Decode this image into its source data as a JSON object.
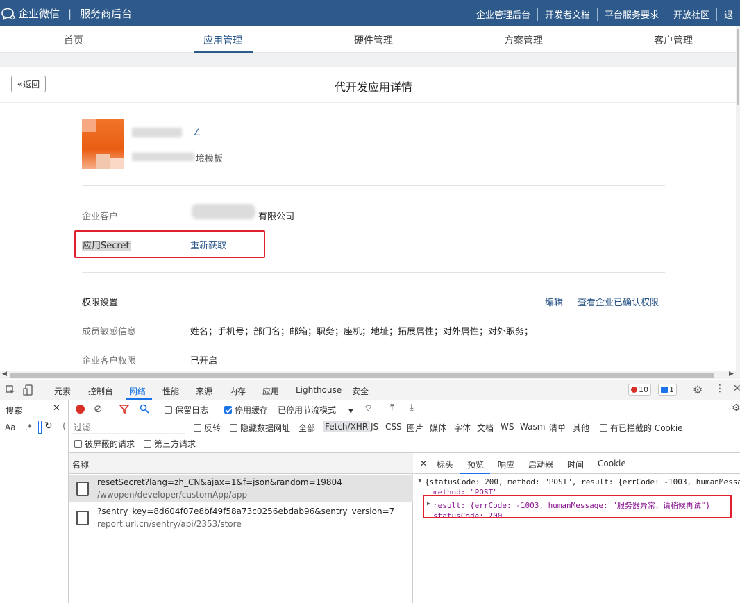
{
  "topbar": {
    "brand": "企业微信",
    "section": "服务商后台",
    "links": [
      "企业管理后台",
      "开发者文档",
      "平台服务要求",
      "开放社区",
      "退"
    ]
  },
  "subnav": {
    "tabs": [
      "首页",
      "应用管理",
      "硬件管理",
      "方案管理",
      "客户管理"
    ],
    "active": "应用管理"
  },
  "page": {
    "back_label": "返回",
    "title": "代开发应用详情",
    "app_name_suffix": "∠",
    "app_desc_suffix": "境模板"
  },
  "details": {
    "customer_label": "企业客户",
    "customer_value_suffix": "有限公司",
    "secret_label": "应用Secret",
    "secret_action": "重新获取",
    "perm_title": "权限设置",
    "perm_edit": "编辑",
    "perm_view": "查看企业已确认权限",
    "member_label": "成员敏感信息",
    "member_value": "姓名；手机号；部门名；邮箱；职务；座机；地址；拓展属性；对外属性；对外职务；",
    "client_perm_label": "企业客户权限",
    "client_perm_value": "已开启"
  },
  "devtools": {
    "tabs": [
      "元素",
      "控制台",
      "网络",
      "性能",
      "来源",
      "内存",
      "应用",
      "Lighthouse",
      "安全"
    ],
    "active_tab": "网络",
    "error_count": "10",
    "message_count": "1",
    "left_search_label": "搜索",
    "aa": "Aa",
    "regex": ".*",
    "toolbar": {
      "preserve_log": "保留日志",
      "disable_cache": "停用缓存",
      "throttle": "已停用节流模式"
    },
    "filter": {
      "placeholder": "过滤",
      "invert": "反转",
      "hide_data_urls": "隐藏数据网址",
      "types": [
        "全部",
        "Fetch/XHR",
        "JS",
        "CSS",
        "图片",
        "媒体",
        "字体",
        "文档",
        "WS",
        "Wasm",
        "清单",
        "其他"
      ],
      "selected_type": "Fetch/XHR",
      "blocked_cookies": "有已拦截的 Cookie",
      "blocked_requests": "被屏蔽的请求",
      "third_party": "第三方请求"
    },
    "requests": {
      "name_header": "名称",
      "items": [
        {
          "name": "resetSecret?lang=zh_CN&ajax=1&f=json&random=19804",
          "path": "/wwopen/developer/customApp/app"
        },
        {
          "name": "?sentry_key=8d604f07e8bf49f58a73c0256ebdab96&sentry_version=7",
          "path": "report.url.cn/sentry/api/2353/store"
        }
      ]
    },
    "preview": {
      "tabs": [
        "标头",
        "预览",
        "响应",
        "启动器",
        "时间",
        "Cookie"
      ],
      "active_tab": "预览",
      "line1": "{statusCode: 200, method: \"POST\", result: {errCode: -1003, humanMessa",
      "method_line": "method: \"POST\"",
      "result_line": "result: {errCode: -1003, humanMessage: \"服务器异常，请稍候再试\"}",
      "status_line": "statusCode: 200"
    }
  }
}
